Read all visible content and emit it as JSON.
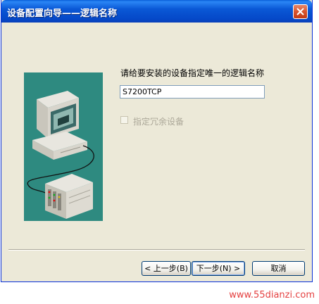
{
  "window": {
    "title": "设备配置向导——逻辑名称"
  },
  "main": {
    "prompt": "请给要安装的设备指定唯一的逻辑名称",
    "name_value": "S7200TCP",
    "redundant_label": "指定冗余设备",
    "redundant_checked": false,
    "redundant_enabled": false
  },
  "buttons": {
    "back_label": "< 上一步(B)",
    "next_label": "下一步(N) >",
    "cancel_label": "取消"
  },
  "watermark": "www.55dianzi.com",
  "colors": {
    "titlebar": "#0548c8",
    "dialog_bg": "#ece9d8",
    "illustration_bg": "#2e8a80",
    "watermark": "#e02020"
  }
}
